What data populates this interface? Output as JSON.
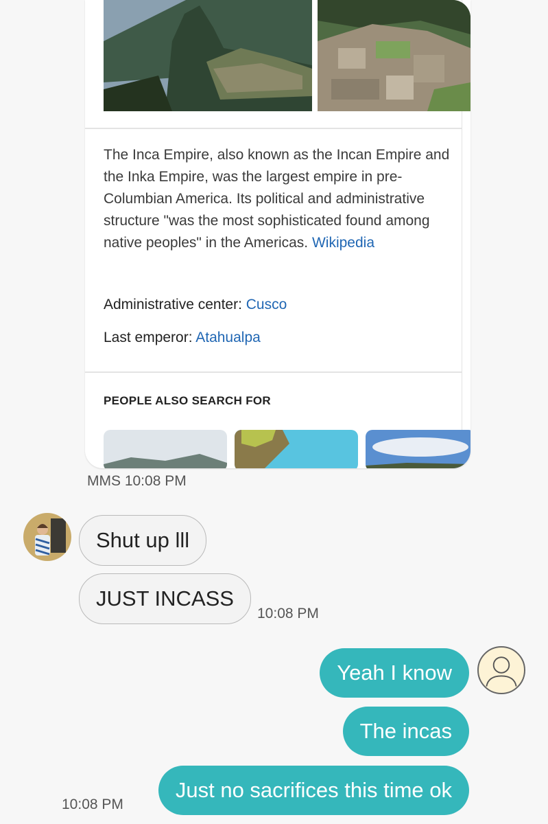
{
  "card": {
    "description": "The Inca Empire, also known as the Incan Empire and the Inka Empire, was the largest empire in pre-Columbian America. Its political and administrative structure \"was the most sophisticated found among native peoples\" in the Americas.",
    "source_link": "Wikipedia",
    "facts": [
      {
        "label": "Administrative center: ",
        "value": "Cusco"
      },
      {
        "label": "Last emperor: ",
        "value": "Atahualpa"
      }
    ],
    "people_also_search_for": "PEOPLE ALSO SEARCH FOR"
  },
  "mms_label": "MMS 10:08 PM",
  "messages": {
    "incoming": [
      {
        "text": "Shut up lll"
      },
      {
        "text": "JUST INCASS",
        "time": "10:08 PM"
      }
    ],
    "outgoing": [
      {
        "text": "Yeah I know"
      },
      {
        "text": "The incas"
      },
      {
        "text": "Just no sacrifices this time ok",
        "time": "10:08 PM"
      }
    ]
  },
  "colors": {
    "outgoing_bubble": "#35b7bb",
    "link": "#1f66b3",
    "background": "#f7f7f7"
  }
}
